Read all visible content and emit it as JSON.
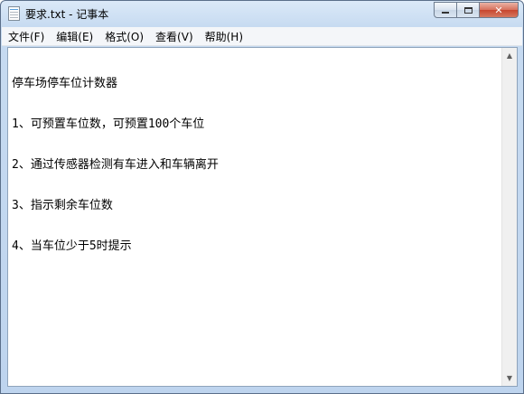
{
  "window": {
    "title": "要求.txt - 记事本",
    "icon": "notepad-icon"
  },
  "caption_buttons": {
    "minimize_icon": "minimize-icon",
    "maximize_icon": "maximize-icon",
    "close_label": "✕"
  },
  "menu": {
    "items": [
      {
        "label": "文件(F)"
      },
      {
        "label": "编辑(E)"
      },
      {
        "label": "格式(O)"
      },
      {
        "label": "查看(V)"
      },
      {
        "label": "帮助(H)"
      }
    ]
  },
  "document": {
    "lines": [
      "停车场停车位计数器",
      "1、可预置车位数，可预置100个车位",
      "2、通过传感器检测有车进入和车辆离开",
      "3、指示剩余车位数",
      "4、当车位少于5时提示"
    ]
  },
  "scrollbar": {
    "up_arrow": "▲",
    "down_arrow": "▼"
  }
}
